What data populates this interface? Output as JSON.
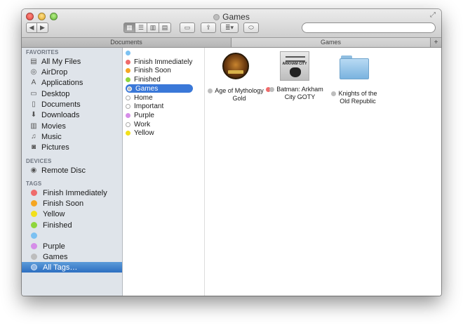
{
  "window": {
    "title": "Games"
  },
  "toolbar": {
    "back_icon": "chevron-left-icon",
    "forward_icon": "chevron-right-icon",
    "view_modes": [
      {
        "name": "icon-view",
        "icon": "grid-icon",
        "selected": true
      },
      {
        "name": "list-view",
        "icon": "list-icon",
        "selected": false
      },
      {
        "name": "column-view",
        "icon": "columns-icon",
        "selected": true
      },
      {
        "name": "coverflow-view",
        "icon": "coverflow-icon",
        "selected": false
      }
    ],
    "search_placeholder": ""
  },
  "tabs": [
    {
      "label": "Documents",
      "active": false
    },
    {
      "label": "Games",
      "active": true
    }
  ],
  "sidebar": {
    "favorites_header": "FAVORITES",
    "favorites": [
      {
        "label": "All My Files",
        "icon": "all-files-icon"
      },
      {
        "label": "AirDrop",
        "icon": "airdrop-icon"
      },
      {
        "label": "Applications",
        "icon": "applications-icon"
      },
      {
        "label": "Desktop",
        "icon": "desktop-icon"
      },
      {
        "label": "Documents",
        "icon": "documents-icon"
      },
      {
        "label": "Downloads",
        "icon": "downloads-icon"
      },
      {
        "label": "Movies",
        "icon": "movies-icon"
      },
      {
        "label": "Music",
        "icon": "music-icon"
      },
      {
        "label": "Pictures",
        "icon": "pictures-icon"
      }
    ],
    "devices_header": "DEVICES",
    "devices": [
      {
        "label": "Remote Disc",
        "icon": "disc-icon"
      }
    ],
    "tags_header": "TAGS",
    "tags": [
      {
        "label": "Finish Immediately",
        "color": "#ef6b6b"
      },
      {
        "label": "Finish Soon",
        "color": "#f5a623"
      },
      {
        "label": "Yellow",
        "color": "#f2e01b"
      },
      {
        "label": "Finished",
        "color": "#8fd63c"
      },
      {
        "label": "",
        "color": "#7cc1f2"
      },
      {
        "label": "Purple",
        "color": "#d58de8"
      },
      {
        "label": "Games",
        "color": "#bdbdbd"
      },
      {
        "label": "All Tags…",
        "color": "#8fb5e3",
        "selected": true
      }
    ]
  },
  "column": {
    "items": [
      {
        "label": "",
        "color": "#7cc1f2",
        "outline": false
      },
      {
        "label": "Finish Immediately",
        "color": "#ef6b6b",
        "outline": false
      },
      {
        "label": "Finish Soon",
        "color": "#f5a623",
        "outline": false
      },
      {
        "label": "Finished",
        "color": "#8fd63c",
        "outline": false
      },
      {
        "label": "Games",
        "color": "#bdbdbd",
        "outline": false,
        "selected": true
      },
      {
        "label": "Home",
        "color": "#ffffff",
        "outline": true
      },
      {
        "label": "Important",
        "color": "#ffffff",
        "outline": true
      },
      {
        "label": "Purple",
        "color": "#d58de8",
        "outline": false
      },
      {
        "label": "Work",
        "color": "#ffffff",
        "outline": true
      },
      {
        "label": "Yellow",
        "color": "#f2e01b",
        "outline": false
      }
    ]
  },
  "files": [
    {
      "line1": "Age of Mythology",
      "line2": "Gold",
      "tag_colors": [
        "#bdbdbd"
      ],
      "icon": "age-of-mythology-icon"
    },
    {
      "line1": "Batman: Arkham",
      "line2": "City GOTY",
      "tag_colors": [
        "#ef6b6b",
        "#bdbdbd"
      ],
      "icon": "batman-arkham-city-icon",
      "icon_text": "ARKHAM CITY"
    },
    {
      "line1": "Knights of the",
      "line2": "Old Republic",
      "tag_colors": [
        "#bdbdbd"
      ],
      "icon": "folder-icon"
    }
  ]
}
